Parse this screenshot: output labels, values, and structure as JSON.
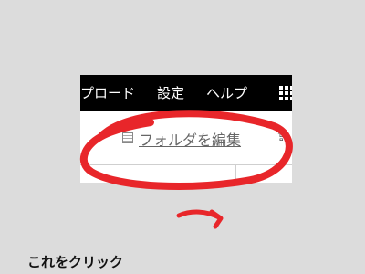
{
  "menubar": {
    "items": [
      "プロード",
      "設定",
      "ヘルプ"
    ]
  },
  "toolbar": {
    "edit_folder_label": "フォルダを編集"
  },
  "caption": "これをクリック",
  "colors": {
    "menubar_bg": "#000000",
    "annotation_red": "#e8262a",
    "page_bg": "#dcdcdc"
  },
  "icons": [
    "grid-icon",
    "document-icon",
    "upload-icon",
    "arrow-icon"
  ]
}
